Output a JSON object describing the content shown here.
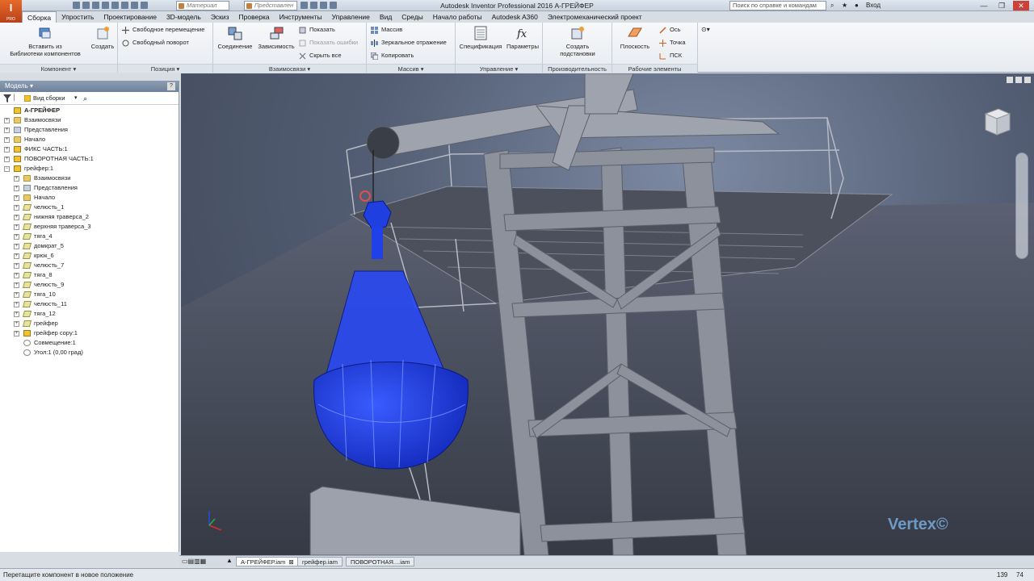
{
  "app": {
    "logo_letter": "I",
    "logo_sub": "PRO",
    "window_title": "Autodesk Inventor Professional 2016   А-ГРЕЙФЕР",
    "material_combo": "Материал",
    "appearance_combo": "Представлен",
    "help_search_placeholder": "Поиск по справке и командам",
    "sign_in": "Вход",
    "win_min": "—",
    "win_max": "❐",
    "win_close": "✕"
  },
  "ribbon_tabs": [
    {
      "label": "Сборка",
      "active": true
    },
    {
      "label": "Упростить"
    },
    {
      "label": "Проектирование"
    },
    {
      "label": "3D-модель"
    },
    {
      "label": "Эскиз"
    },
    {
      "label": "Проверка"
    },
    {
      "label": "Инструменты"
    },
    {
      "label": "Управление"
    },
    {
      "label": "Вид"
    },
    {
      "label": "Среды"
    },
    {
      "label": "Начало работы"
    },
    {
      "label": "Autodesk A360"
    },
    {
      "label": "Электромеханический проект"
    }
  ],
  "ribbon": {
    "component": {
      "title": "Компонент ▾",
      "insert_label": "Вставить из\nБиблиотеки компонентов",
      "create_label": "Создать"
    },
    "position": {
      "title": "Позиция ▾",
      "free_move": "Свободное перемещение",
      "free_rotate": "Свободный поворот"
    },
    "relationships": {
      "title": "Взаимосвязи ▾",
      "joint": "Соединение",
      "constrain": "Зависимость",
      "show": "Показать",
      "show_sick": "Показать ошибки",
      "hide_all": "Скрыть все"
    },
    "pattern": {
      "title": "Массив ▾",
      "pattern": "Массив",
      "mirror": "Зеркальное отражение",
      "copy": "Копировать"
    },
    "manage": {
      "title": "Управление ▾",
      "bom": "Спецификация",
      "params": "Параметры"
    },
    "productivity": {
      "title": "Производительность",
      "create_sub": "Создать\nподстановки"
    },
    "work_features": {
      "title": "Рабочие элементы",
      "plane": "Плоскость",
      "axis": "Ось",
      "point": "Точка",
      "ucs": "ПСК"
    }
  },
  "browser": {
    "title": "Модель ▾",
    "help": "?",
    "view_label": "Вид сборки",
    "tree": [
      {
        "label": "А-ГРЕЙФЕР",
        "level": 0,
        "icon": "asm",
        "bold": true
      },
      {
        "label": "Взаимосвязи",
        "level": 0,
        "icon": "folder",
        "exp": "+"
      },
      {
        "label": "Представления",
        "level": 0,
        "icon": "view",
        "exp": "+"
      },
      {
        "label": "Начало",
        "level": 0,
        "icon": "folder",
        "exp": "+"
      },
      {
        "label": "ФИКС ЧАСТЬ:1",
        "level": 0,
        "icon": "asm",
        "exp": "+"
      },
      {
        "label": "ПОВОРОТНАЯ ЧАСТЬ:1",
        "level": 0,
        "icon": "asm",
        "exp": "+"
      },
      {
        "label": "грейфер:1",
        "level": 0,
        "icon": "asm",
        "exp": "−"
      },
      {
        "label": "Взаимосвязи",
        "level": 1,
        "icon": "folder",
        "exp": "+"
      },
      {
        "label": "Представления",
        "level": 1,
        "icon": "view",
        "exp": "+"
      },
      {
        "label": "Начало",
        "level": 1,
        "icon": "folder",
        "exp": "+"
      },
      {
        "label": "челюсть_1",
        "level": 1,
        "icon": "part",
        "exp": "+"
      },
      {
        "label": "нижняя траверса_2",
        "level": 1,
        "icon": "part",
        "exp": "+"
      },
      {
        "label": "верхняя траверса_3",
        "level": 1,
        "icon": "part",
        "exp": "+"
      },
      {
        "label": "тяга_4",
        "level": 1,
        "icon": "part",
        "exp": "+"
      },
      {
        "label": "домкрат_5",
        "level": 1,
        "icon": "part",
        "exp": "+"
      },
      {
        "label": "крюк_6",
        "level": 1,
        "icon": "part",
        "exp": "+"
      },
      {
        "label": "челюсть_7",
        "level": 1,
        "icon": "part",
        "exp": "+"
      },
      {
        "label": "тяга_8",
        "level": 1,
        "icon": "part",
        "exp": "+"
      },
      {
        "label": "челюсть_9",
        "level": 1,
        "icon": "part",
        "exp": "+"
      },
      {
        "label": "тяга_10",
        "level": 1,
        "icon": "part",
        "exp": "+"
      },
      {
        "label": "челюсть_11",
        "level": 1,
        "icon": "part",
        "exp": "+"
      },
      {
        "label": "тяга_12",
        "level": 1,
        "icon": "part",
        "exp": "+"
      },
      {
        "label": "грейфер",
        "level": 1,
        "icon": "part",
        "exp": "+"
      },
      {
        "label": "грейфер copy:1",
        "level": 1,
        "icon": "asm",
        "exp": "+"
      },
      {
        "label": "Совмещение:1",
        "level": 1,
        "icon": "constr"
      },
      {
        "label": "Угол:1 (0,00 град)",
        "level": 1,
        "icon": "constr"
      }
    ]
  },
  "viewport": {
    "viewcube_label": "",
    "watermark": "Vertex©"
  },
  "doc_tabs": [
    {
      "label": "А-ГРЕЙФЕР.iam",
      "active": true,
      "close": "⊠"
    },
    {
      "label": "грейфер.iam"
    },
    {
      "label": "ПОВОРОТНАЯ....iam"
    }
  ],
  "status": {
    "message": "Перетащите компонент в новое положение",
    "count_a": "139",
    "count_b": "74"
  },
  "colors": {
    "selection_blue": "#1f3fe0",
    "accent_orange": "#d6571f"
  }
}
